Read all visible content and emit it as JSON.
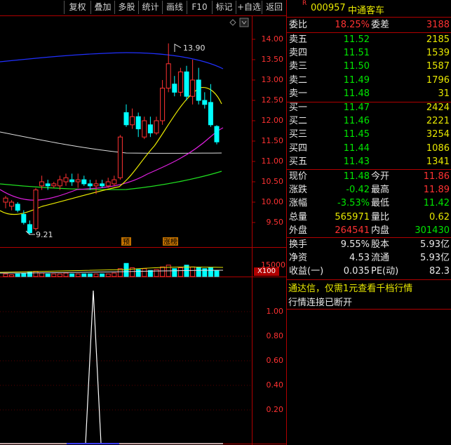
{
  "toolbar": {
    "buttons": [
      "复权",
      "叠加",
      "多股",
      "统计",
      "画线",
      "F10",
      "标记",
      "+自选",
      "返回"
    ]
  },
  "stock": {
    "badge": "R",
    "code": "000957",
    "name": "中通客车"
  },
  "ratio": {
    "wb_label": "委比",
    "wb_value": "18.25%",
    "wc_label": "委差",
    "wc_value": "3188"
  },
  "asks": [
    {
      "label": "卖五",
      "price": "11.52",
      "vol": "2185"
    },
    {
      "label": "卖四",
      "price": "11.51",
      "vol": "1539"
    },
    {
      "label": "卖三",
      "price": "11.50",
      "vol": "1587"
    },
    {
      "label": "卖二",
      "price": "11.49",
      "vol": "1796"
    },
    {
      "label": "卖一",
      "price": "11.48",
      "vol": "31"
    }
  ],
  "bids": [
    {
      "label": "买一",
      "price": "11.47",
      "vol": "2424"
    },
    {
      "label": "买二",
      "price": "11.46",
      "vol": "2221"
    },
    {
      "label": "买三",
      "price": "11.45",
      "vol": "3254"
    },
    {
      "label": "买四",
      "price": "11.44",
      "vol": "1086"
    },
    {
      "label": "买五",
      "price": "11.43",
      "vol": "1341"
    }
  ],
  "quote": [
    {
      "l1": "现价",
      "v1": "11.48",
      "l2": "今开",
      "v2": "11.86"
    },
    {
      "l1": "涨跌",
      "v1": "-0.42",
      "l2": "最高",
      "v2": "11.89"
    },
    {
      "l1": "涨幅",
      "v1": "-3.53%",
      "l2": "最低",
      "v2": "11.42"
    },
    {
      "l1": "总量",
      "v1": "565971",
      "l2": "量比",
      "v2": "0.62"
    },
    {
      "l1": "外盘",
      "v1": "264541",
      "l2": "内盘",
      "v2": "301430"
    }
  ],
  "stats": [
    {
      "l1": "换手",
      "v1": "9.55%",
      "l2": "股本",
      "v2": "5.93亿"
    },
    {
      "l1": "净资",
      "v1": "4.53",
      "l2": "流通",
      "v2": "5.93亿"
    },
    {
      "l1": "收益(一)",
      "v1": "0.035",
      "l2": "PE(动)",
      "v2": "82.3"
    }
  ],
  "notice": {
    "line1": "通达信，仅需1元查看千档行情",
    "line2": "行情连接已断开"
  },
  "kline": {
    "y_ticks": [
      "14.00",
      "13.50",
      "13.00",
      "12.50",
      "12.00",
      "11.50",
      "11.00",
      "10.50",
      "10.00",
      "9.50"
    ],
    "high_label": "13.90",
    "low_label": "9.21",
    "markers": [
      "预",
      "涨榜"
    ]
  },
  "volume": {
    "tick": "15000",
    "unit": "X100"
  },
  "indicator": {
    "y_ticks": [
      "1.00",
      "0.80",
      "0.60",
      "0.40",
      "0.20"
    ]
  },
  "colors": {
    "up": "#ff3232",
    "down": "#00ffff",
    "grid": "#b00000",
    "text_green": "#00e600",
    "text_yellow": "#e8e800"
  }
}
